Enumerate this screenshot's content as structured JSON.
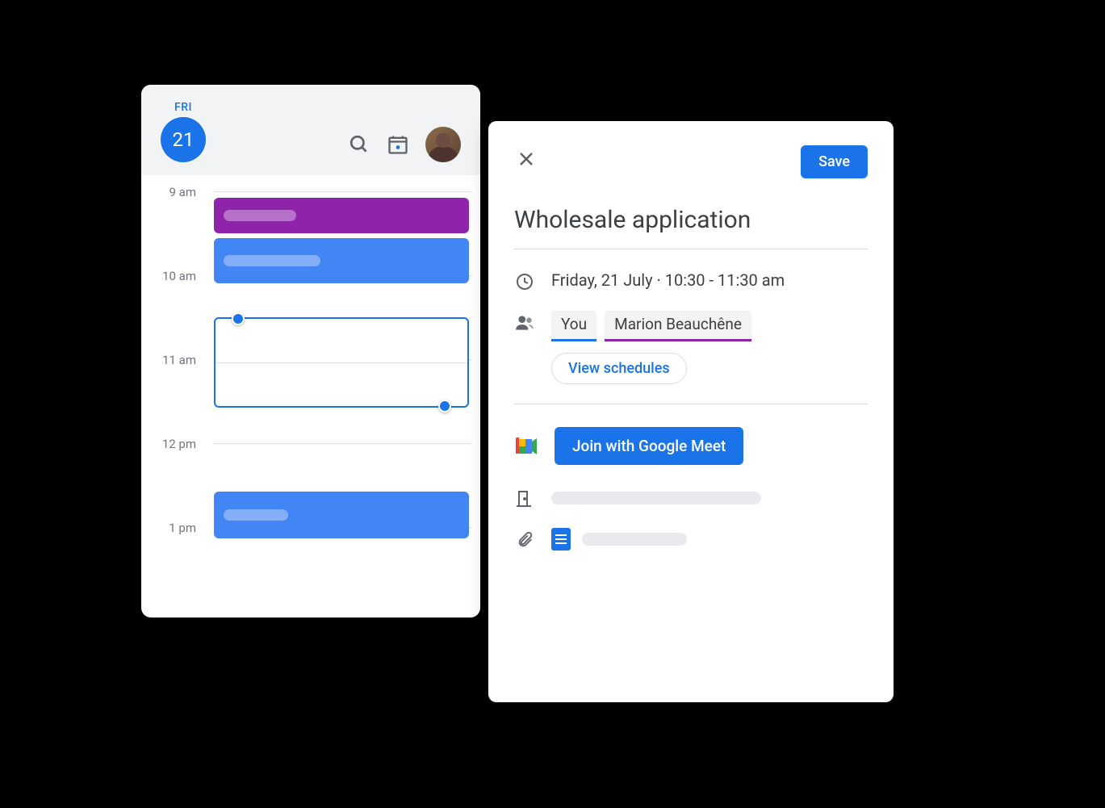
{
  "calendar": {
    "day_label": "FRI",
    "date_number": "21",
    "hours": [
      "9 am",
      "10 am",
      "11 am",
      "12 pm",
      "1 pm"
    ]
  },
  "event": {
    "save_label": "Save",
    "title": "Wholesale application",
    "datetime_text": "Friday, 21 July  ·  10:30 - 11:30 am",
    "attendees": {
      "you_label": "You",
      "guest_name": "Marion Beauchêne"
    },
    "view_schedules_label": "View schedules",
    "meet_button_label": "Join with Google Meet"
  }
}
